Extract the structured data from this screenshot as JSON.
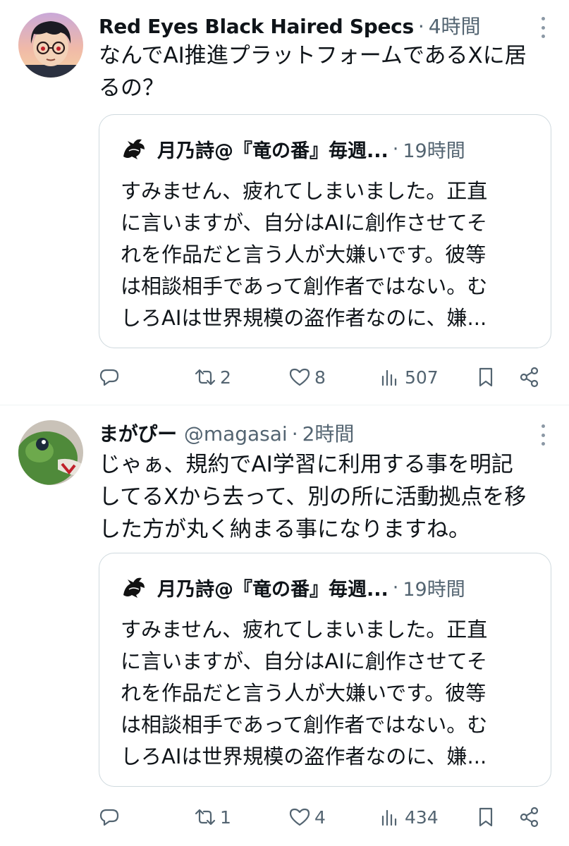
{
  "tweets": [
    {
      "display_name": "Red Eyes Black Haired Specs",
      "handle": "",
      "dot": "·",
      "time": "4時間",
      "text": "なんでAI推進プラットフォームであるXに居\nるの？",
      "quote": {
        "name": "月乃詩@『竜の番』毎週...",
        "dot": "·",
        "time": "19時間",
        "text": "すみません、疲れてしまいました。正直\nに言いますが、自分はAIに創作させてそ\nれを作品だと言う人が大嫌いです。彼等\nは相談相手であって創作者ではない。む\nしろAIは世界規模の盗作者なのに、嫌..."
      },
      "stats": {
        "replies": "",
        "retweets": "2",
        "likes": "8",
        "views": "507"
      }
    },
    {
      "display_name": "まがぴー",
      "handle": "@magasai",
      "dot": "·",
      "time": "2時間",
      "text": "じゃぁ、規約でAI学習に利用する事を明記\nしてるXから去って、別の所に活動拠点を移\nした方が丸く納まる事になりますね。",
      "quote": {
        "name": "月乃詩@『竜の番』毎週...",
        "dot": "·",
        "time": "19時間",
        "text": "すみません、疲れてしまいました。正直\nに言いますが、自分はAIに創作させてそ\nれを作品だと言う人が大嫌いです。彼等\nは相談相手であって創作者ではない。む\nしろAIは世界規模の盗作者なのに、嫌..."
      },
      "stats": {
        "replies": "",
        "retweets": "1",
        "likes": "4",
        "views": "434"
      }
    }
  ],
  "icons": {
    "reply": "reply-icon",
    "retweet": "retweet-icon",
    "like": "heart-icon",
    "views": "views-icon",
    "bookmark": "bookmark-icon",
    "share": "share-icon",
    "more": "more-dots-icon"
  },
  "colors": {
    "text": "#0f1419",
    "secondary": "#536471",
    "border": "#cfd9de",
    "divider": "#eff3f4"
  }
}
